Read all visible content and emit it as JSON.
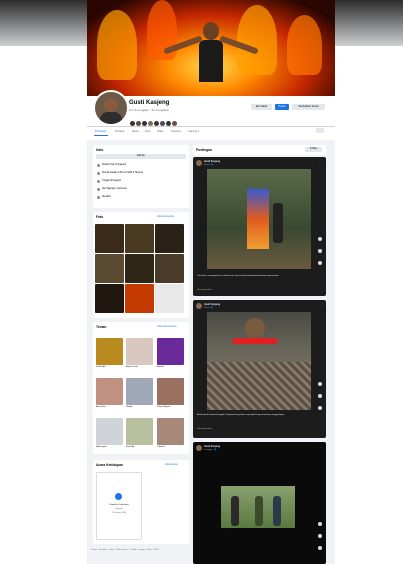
{
  "profile": {
    "name": "Gusti Kasjeng",
    "followers": "8,1 rb pengikut · 31 mengikuti",
    "buttons": [
      "Ikuti kabar",
      "Pesan",
      "Tambahkan teman"
    ]
  },
  "tabs": [
    "Postingan",
    "Tentang",
    "Reels",
    "Foto",
    "Video",
    "Check-in",
    "Lainnya ▾"
  ],
  "intro": {
    "title": "Intro",
    "edit_label": "Edit bio",
    "items": [
      "Pelatih Fisik di Nganjuk",
      "Pernah belajar di Ilmu di SMA 2 Tanjung",
      "Tinggal di Nganjuk",
      "Dari Nganjuk, Indonesia",
      "Menikah"
    ]
  },
  "photos": {
    "title": "Foto",
    "link": "Lihat semua foto"
  },
  "friends": {
    "title": "Teman",
    "link": "Lihat semua teman",
    "names": [
      "Paul Budhi",
      "Andris Dandi",
      "Brahma",
      "Ainun Nisa",
      "Rizaldi",
      "Cahya Mulyani",
      "Nadiansyah",
      "Fachri Aji",
      "Yuliani R."
    ]
  },
  "events": {
    "title": "Acara Kehidupan",
    "link": "Lihat semua",
    "card_text": "Pindah ke kota baru",
    "card_sub": "Nganjuk",
    "card_date": "18 Januari 2018"
  },
  "posts_header": {
    "title": "Postingan",
    "filter_label": "⇅ Filter"
  },
  "posts": [
    {
      "author": "Gusti Kasjeng",
      "time": "3 hari · 🌐",
      "caption": "Tahun baru, semangat baru. Latihan terus tiap hari demi hasil terbaik bersama teman-teman.",
      "meta": "Lihat terjemahan"
    },
    {
      "author": "Gusti Kasjeng",
      "time": "5 hari · 🌐",
      "caption": "Bersih-bersih halaman bengkel. Tumpukan kayu bekas siap dipakai lagi untuk kerja minggu depan.",
      "meta": "Lihat terjemahan"
    },
    {
      "author": "Gusti Kasjeng",
      "time": "1 minggu · 🌐",
      "caption": "",
      "meta": ""
    }
  ],
  "footer": "Privasi · Ketentuan · Iklan · Pilihan Iklan ▷ · Cookie · Lainnya · Meta © 2024",
  "colors": {
    "accent": "#1b74e4",
    "bg": "#f0f2f5",
    "post_bg": "#1c1c1c"
  }
}
